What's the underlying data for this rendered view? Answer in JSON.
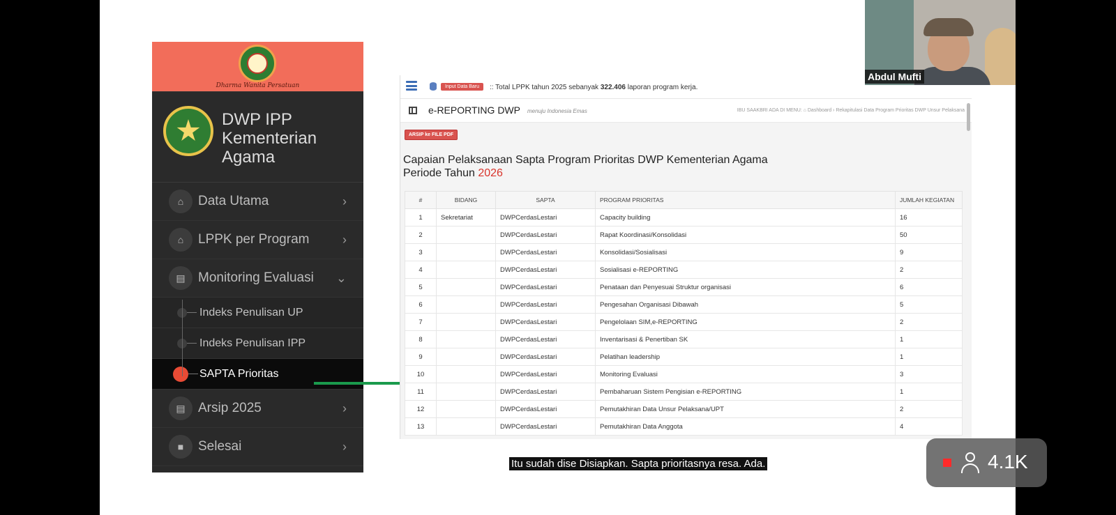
{
  "sidebar": {
    "motto": "Dharma Wanita Persatuan",
    "title": "DWP IPP Kementerian Agama",
    "items": [
      {
        "label": "Data Utama",
        "chevron": "›"
      },
      {
        "label": "LPPK per Program",
        "chevron": "›"
      },
      {
        "label": "Monitoring Evaluasi",
        "chevron": "⌄"
      }
    ],
    "subitems": [
      {
        "label": "Indeks Penulisan UP"
      },
      {
        "label": "Indeks Penulisan IPP"
      },
      {
        "label": "SAPTA Prioritas"
      }
    ],
    "items_after": [
      {
        "label": "Arsip 2025",
        "chevron": "›"
      },
      {
        "label": "Selesai",
        "chevron": "›"
      }
    ]
  },
  "app": {
    "topbar": {
      "input_button": "Input Data Baru",
      "text_prefix": ":: Total LPPK tahun 2025 sebanyak ",
      "text_count": "322.406",
      "text_suffix": " laporan program kerja."
    },
    "title": "e-REPORTING DWP",
    "subtitle": "menuju Indonesia Emas",
    "breadcrumb": "IBU SAAKBRI ADA DI MENU:  ⌂ Dashboard  ›  Rekapitulasi Data Program Prioritas DWP Unsur Pelaksana",
    "pdf_button": "ARSIP ke FILE PDF",
    "heading_line1": "Capaian Pelaksanaan Sapta Program Prioritas DWP Kementerian Agama",
    "heading_line2_prefix": "Periode Tahun ",
    "heading_year": "2026",
    "table": {
      "headers": [
        "#",
        "BIDANG",
        "SAPTA",
        "PROGRAM PRIORITAS",
        "JUMLAH KEGIATAN"
      ],
      "rows": [
        [
          "1",
          "Sekretariat",
          "DWPCerdasLestari",
          "Capacity building",
          "16"
        ],
        [
          "2",
          "",
          "DWPCerdasLestari",
          "Rapat Koordinasi/Konsolidasi",
          "50"
        ],
        [
          "3",
          "",
          "DWPCerdasLestari",
          "Konsolidasi/Sosialisasi",
          "9"
        ],
        [
          "4",
          "",
          "DWPCerdasLestari",
          "Sosialisasi e-REPORTING",
          "2"
        ],
        [
          "5",
          "",
          "DWPCerdasLestari",
          "Penataan dan Penyesuai Struktur organisasi",
          "6"
        ],
        [
          "6",
          "",
          "DWPCerdasLestari",
          "Pengesahan Organisasi Dibawah",
          "5"
        ],
        [
          "7",
          "",
          "DWPCerdasLestari",
          "Pengelolaan SIM,e-REPORTING",
          "2"
        ],
        [
          "8",
          "",
          "DWPCerdasLestari",
          "Inventarisasi & Penertiban SK",
          "1"
        ],
        [
          "9",
          "",
          "DWPCerdasLestari",
          "Pelatihan leadership",
          "1"
        ],
        [
          "10",
          "",
          "DWPCerdasLestari",
          "Monitoring Evaluasi",
          "3"
        ],
        [
          "11",
          "",
          "DWPCerdasLestari",
          "Pembaharuan Sistem Pengisian e-REPORTING",
          "1"
        ],
        [
          "12",
          "",
          "DWPCerdasLestari",
          "Pemutakhiran Data Unsur Pelaksana/UPT",
          "2"
        ],
        [
          "13",
          "",
          "DWPCerdasLestari",
          "Pemutakhiran Data Anggota",
          "4"
        ]
      ]
    }
  },
  "webcam": {
    "name": "Abdul Mufti"
  },
  "caption": "Itu sudah dise Disiapkan. Sapta prioritasnya resa. Ada.",
  "viewers": {
    "count": "4.1K"
  },
  "colors": {
    "accent_red": "#d9534f",
    "arrow_green": "#1a9a4c",
    "banner_salmon": "#f26d5a",
    "year_red": "#d9342b"
  }
}
